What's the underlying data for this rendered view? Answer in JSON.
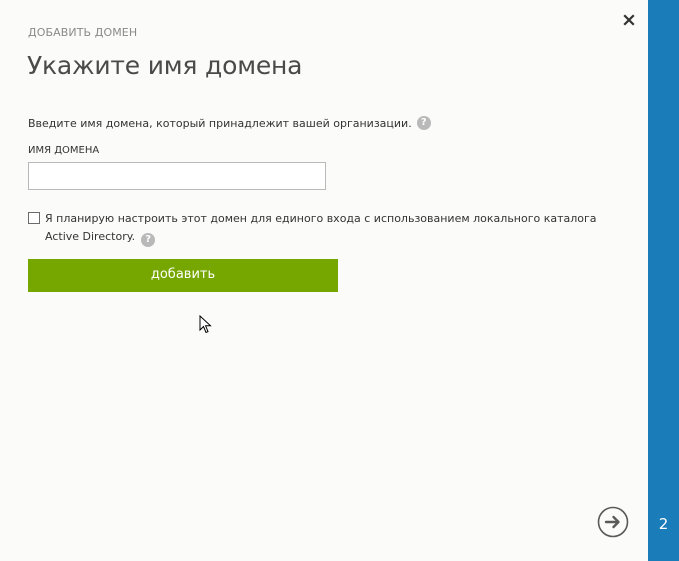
{
  "dialog": {
    "eyebrow": "ДОБАВИТЬ ДОМЕН",
    "title": "Укажите имя домена",
    "description": "Введите имя домена, который принадлежит вашей организации.",
    "domain_field": {
      "label": "ИМЯ ДОМЕНА",
      "value": "",
      "placeholder": ""
    },
    "sso_checkbox": {
      "checked": false,
      "label": "Я планирую настроить этот домен для единого входа с использованием локального каталога Active Directory."
    },
    "add_button_label": "добавить",
    "help_glyph": "?"
  },
  "side_panel": {
    "step_number": "2"
  },
  "colors": {
    "accent_green": "#76a700",
    "side_panel_blue": "#1a7cb8",
    "help_icon_gray": "#b9b9b9"
  },
  "icons": {
    "close": "close-icon",
    "help": "help-icon",
    "next": "arrow-right-circle-icon",
    "cursor": "mouse-cursor-icon"
  }
}
